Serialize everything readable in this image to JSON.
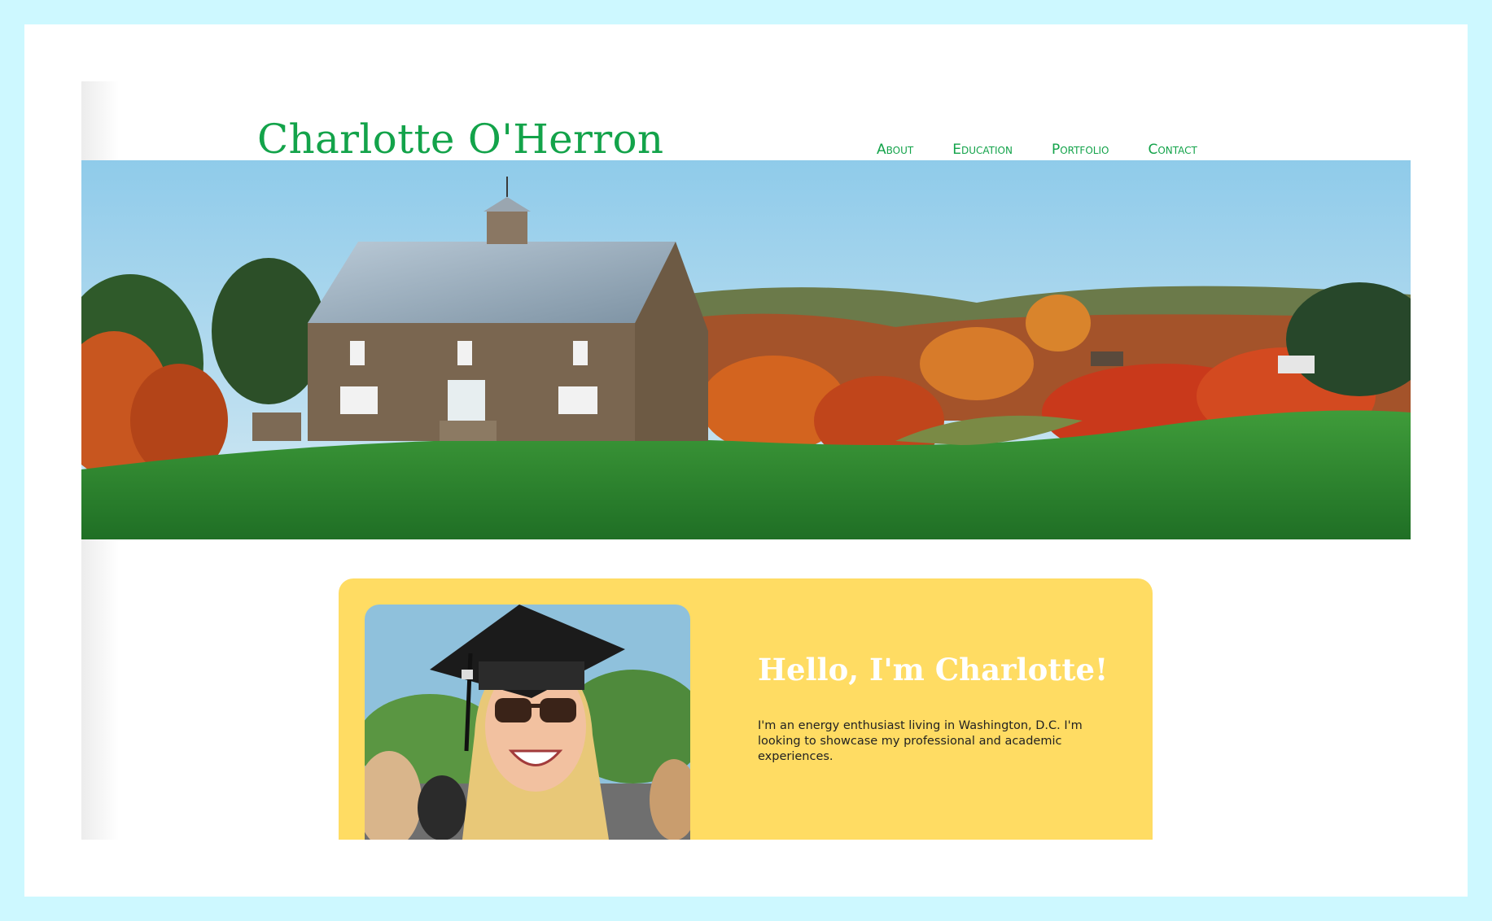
{
  "site": {
    "title": "Charlotte O'Herron"
  },
  "nav": {
    "items": [
      {
        "label": "About"
      },
      {
        "label": "Education"
      },
      {
        "label": "Portfolio"
      },
      {
        "label": "Contact"
      }
    ]
  },
  "hero": {
    "image": "autumn-barn-landscape"
  },
  "intro": {
    "heading": "Hello, I'm Charlotte!",
    "body": "I'm an energy enthusiast living in Washington, D.C. I'm looking to showcase my professional and academic experiences.",
    "photo": "graduation-portrait"
  },
  "colors": {
    "background": "#cdf8ff",
    "brand_green": "#13a34a",
    "card_yellow": "#ffdc63"
  }
}
